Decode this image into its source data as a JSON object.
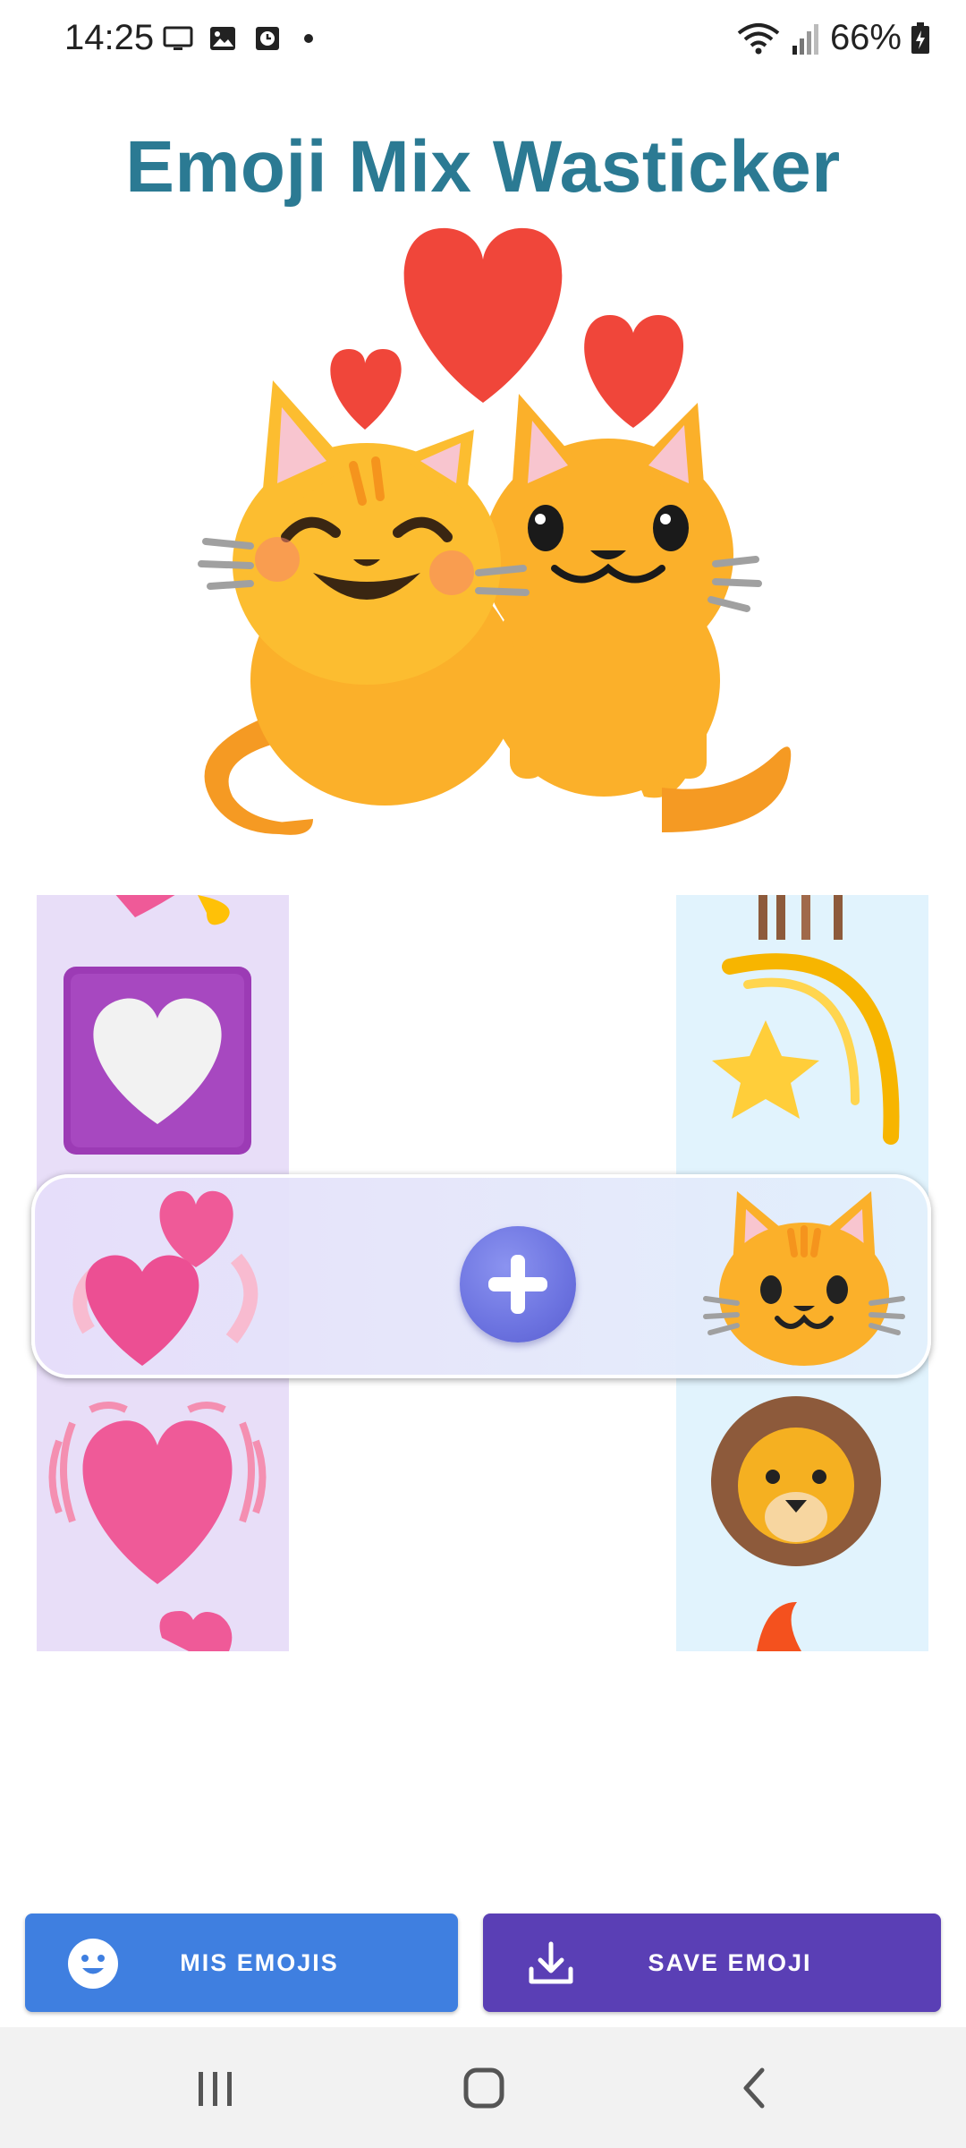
{
  "status_bar": {
    "time": "14:25",
    "battery": "66%",
    "icons": [
      "screen-cast-icon",
      "image-icon",
      "clock-icon",
      "notification-dot",
      "wifi-icon",
      "signal-icon",
      "battery-charging-icon"
    ]
  },
  "title": "Emoji Mix Wasticker",
  "hero": {
    "emoji": "cat-heart-mix",
    "description_icons": [
      "red-heart",
      "happy-cat",
      "cat"
    ]
  },
  "left_picker": {
    "items": [
      "partial-heart-emoji",
      "white-heart-purple-square",
      "revolving-hearts",
      "beating-heart",
      "partial-heart-emoji"
    ],
    "selected": "revolving-hearts"
  },
  "right_picker": {
    "items": [
      "horse-legs-emoji",
      "dizzy-star",
      "cat-face",
      "lion-face",
      "partial-fire-emoji"
    ],
    "selected": "cat-face"
  },
  "actions": {
    "my_emojis": "MIS EMOJIS",
    "save_emoji": "SAVE EMOJI"
  },
  "colors": {
    "title": "#2b7a93",
    "my_emojis_button": "#3f7fe0",
    "save_button": "#5a3fb5",
    "left_picker_bg": "#e8def8",
    "right_picker_bg": "#e1f3fd"
  }
}
